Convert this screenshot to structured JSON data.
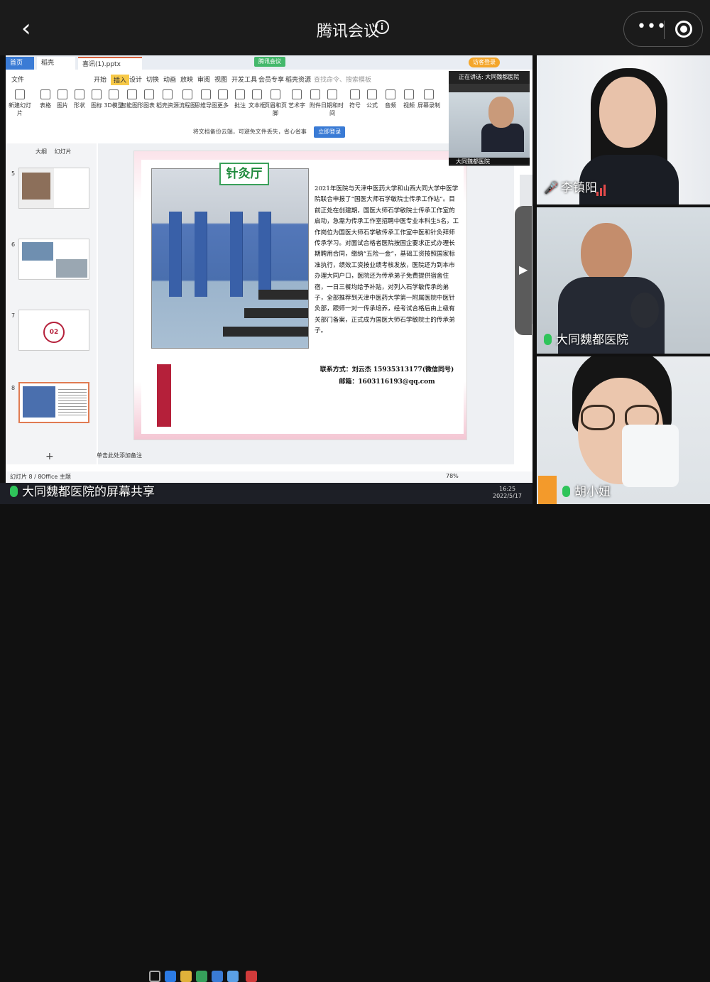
{
  "app": {
    "title": "腾讯会议",
    "back_label": "‹",
    "more_label": "•••"
  },
  "share": {
    "tabs": {
      "home": "首页",
      "doc": "稻壳",
      "ppt": "喜讯(1).pptx"
    },
    "meeting_tag": "腾讯会议",
    "visitor_label": "访客登录",
    "menu": [
      "文件",
      "开始",
      "插入",
      "设计",
      "切换",
      "动画",
      "放映",
      "审阅",
      "视图",
      "开发工具",
      "会员专享",
      "稻壳资源",
      "查找命令、搜索模板"
    ],
    "ribbon": [
      "新建幻灯片",
      "表格",
      "图片",
      "形状",
      "图标",
      "3D模型",
      "智能图形",
      "图表",
      "稻壳资源",
      "流程图",
      "思维导图",
      "更多",
      "批注",
      "文本框",
      "页眉和页脚",
      "艺术字",
      "附件",
      "日期和时间",
      "符号",
      "公式",
      "音频",
      "视频",
      "屏幕录制"
    ],
    "notice": "将文档备份云端，可避免文件丢失，省心省事",
    "notice_btn": "立即登录",
    "panel_tabs": [
      "大纲",
      "幻灯片"
    ],
    "slide_numbers": [
      "5",
      "6",
      "7",
      "8"
    ],
    "thumb7_num": "02",
    "slide": {
      "title": "针灸厅",
      "body": "2021年医院与天津中医药大学和山西大同大学中医学院联合申报了“国医大师石学敏院士传承工作站”。目前正处在创建期，国医大师石学敏院士传承工作室的启动，急需为传承工作室招聘中医专业本科生5名，工作岗位为国医大师石学敏传承工作室中医和针灸拜师传承学习。对面试合格者医院按国企要求正式办理长期聘用合同，缴纳“五险一金”，基础工资按照国家标准执行，绩效工资按业绩考核发放，医院还为到本市办理大同户口，医院还为传承弟子免费提供宿舍住宿，一日三餐均给予补贴，对列入石学敏传承的弟子，全部推荐到天津中医药大学第一附属医院中医针灸部，跟师一对一传承培养，经考试合格后由上级有关部门备案，正式成为国医大师石学敏院士的传承弟子。",
      "contact_line1": "联系方式：刘云杰 15935313177(微信同号)",
      "contact_line2": "邮箱：1603116193@qq.com"
    },
    "notes_placeholder": "单击此处添加备注",
    "status_left": "幻灯片 8 / 8",
    "status_theme": "Office 主题",
    "zoom": "78%",
    "speaker_header": "正在讲话: 大同魏都医院",
    "speaker_name": "大同魏都医院",
    "clock_time": "16:25",
    "clock_date": "2022/5/17"
  },
  "share_label": "大同魏都医院的屏幕共享",
  "participants": [
    {
      "name": "李镇阳"
    },
    {
      "name": "大同魏都医院"
    },
    {
      "name": "胡小妞"
    }
  ],
  "colors": {
    "accent": "#3a7bd5",
    "slide_title_green": "#1f8a3c",
    "mic_green": "#2fc45a"
  }
}
